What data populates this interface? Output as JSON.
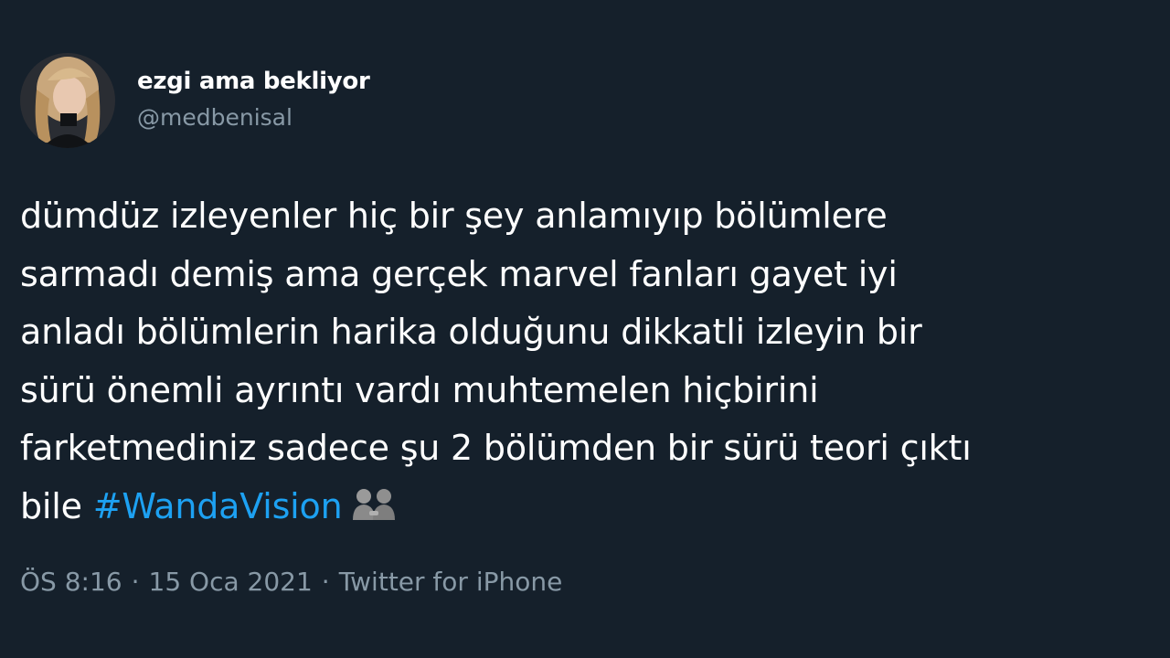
{
  "user": {
    "display_name": "ezgi ama bekliyor",
    "handle": "@medbenisal",
    "avatar_icon": "profile-photo"
  },
  "tweet": {
    "lines": [
      "dümdüz izleyenler hiç bir şey anlamıyıp bölümlere",
      "sarmadı demiş ama gerçek marvel fanları gayet iyi",
      "anladı bölümlerin harika olduğunu dikkatli izleyin bir",
      "sürü önemli ayrıntı vardı muhtemelen hiçbirini",
      "farketmediniz sadece şu 2 bölümden bir sürü teori çıktı"
    ],
    "last_line_prefix": "bile ",
    "hashtag": "#WandaVision",
    "emoji_icon": "two-men-holding-hands-emoji"
  },
  "meta": {
    "time": "ÖS 8:16",
    "date": "15 Oca 2021",
    "source": "Twitter for iPhone",
    "separator": "·"
  },
  "colors": {
    "background": "#15202b",
    "text": "#ffffff",
    "secondary": "#8899a6",
    "link": "#1da1f2"
  }
}
